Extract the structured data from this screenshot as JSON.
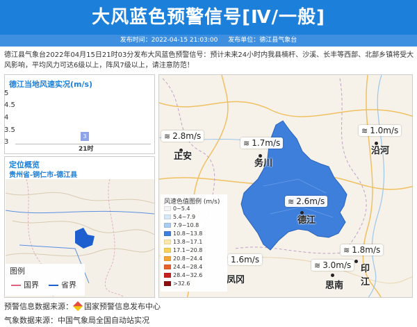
{
  "header": {
    "title": "大风蓝色预警信号[Ⅳ/一般]",
    "publish_time": "发布时间：2022-04-15 21:03:00",
    "publisher": "发布单位：德江县气象台"
  },
  "description": "德江县气象台2022年04月15日21时03分发布大风蓝色预警信号：预计未来24小时内我县楠杆、沙溪、长丰等西部、北部乡镇将受大风影响，平均风力可达6级以上，阵风7级以上，请注意防范！",
  "wind_chart": {
    "title": "德江当地风速实况(m/s)",
    "yticks": [
      "5",
      "4.5",
      "4",
      "3.5",
      "3"
    ],
    "bar_value": "3",
    "x_label": "21时"
  },
  "location": {
    "title": "定位概览",
    "path": "贵州省-铜仁市-德江县",
    "legend_title": "图例",
    "legend_items": [
      "国界",
      "省界"
    ],
    "legend_colors": [
      "#e06080",
      "#1e5fcf"
    ]
  },
  "map": {
    "stations": [
      {
        "name": "正安",
        "speed": "2.8m/s"
      },
      {
        "name": "务川",
        "speed": "1.7m/s"
      },
      {
        "name": "沿河",
        "speed": "1.0m/s"
      },
      {
        "name": "德江",
        "speed": "2.6m/s"
      },
      {
        "name": "凤冈",
        "speed": "1.6m/s"
      },
      {
        "name": "思南",
        "speed": "3.0m/s"
      },
      {
        "name": "印江",
        "speed": "1.8m/s"
      }
    ],
    "legend_title": "风速色值图例 (m/s)",
    "legend_items": [
      "0~5.4",
      "5.4~7.9",
      "7.9~10.8",
      "10.8~13.8",
      "13.8~17.1",
      "17.1~20.8",
      "20.8~24.4",
      "24.4~28.4",
      "28.4~32.6",
      ">32.6"
    ],
    "legend_colors": [
      "#f5f5f5",
      "#d6e8f7",
      "#a9ccf0",
      "#3f7fdc",
      "#fde9a8",
      "#fbd35a",
      "#f7a534",
      "#e8612a",
      "#c8201f",
      "#8b0e0e"
    ],
    "region_color": "#3f7fdc"
  },
  "footer": {
    "warning_source": "预警信息数据来源：",
    "warning_source_name": "国家预警信息发布中心",
    "weather_source": "气象数据来源：中国气象局全国自动站实况"
  }
}
